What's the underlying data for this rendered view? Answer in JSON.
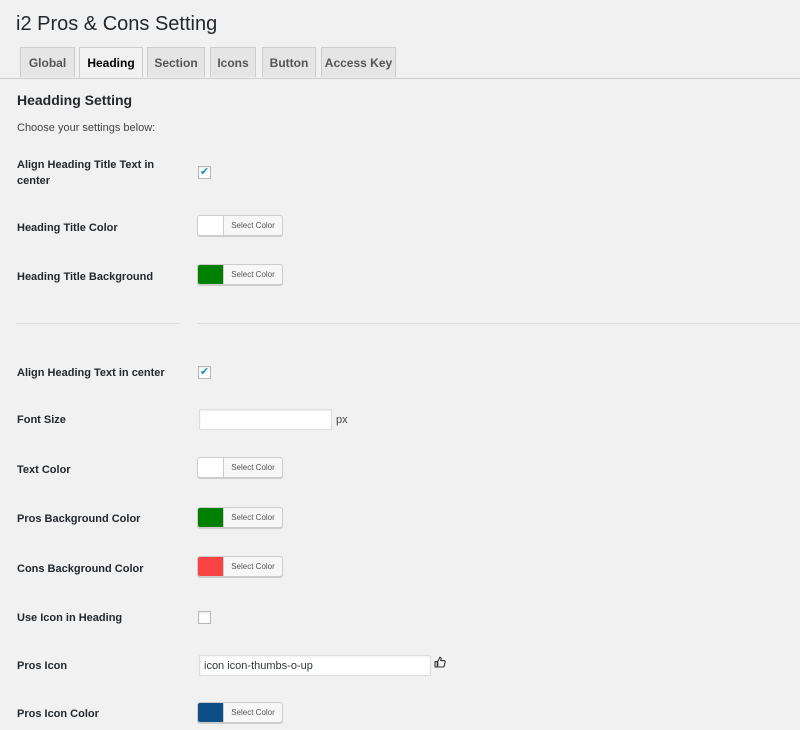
{
  "page": {
    "title": "i2 Pros & Cons Setting"
  },
  "tabs": [
    {
      "label": "Global"
    },
    {
      "label": "Heading",
      "active": true
    },
    {
      "label": "Section"
    },
    {
      "label": "Icons"
    },
    {
      "label": "Button"
    },
    {
      "label": "Access Key"
    }
  ],
  "heading_setting": {
    "title": "Headding Setting",
    "intro": "Choose your settings below:",
    "align_title_center": {
      "label": "Align Heading Title Text in center",
      "checked": true
    },
    "title_color": {
      "label": "Heading Title Color",
      "button": "Select Color",
      "color": "#ffffff"
    },
    "title_background": {
      "label": "Heading Title Background",
      "button": "Select Color",
      "color": "#008000"
    }
  },
  "heading_text": {
    "align_text_center": {
      "label": "Align Heading Text in center",
      "checked": true
    },
    "font_size": {
      "label": "Font Size",
      "value": "",
      "unit": "px"
    },
    "text_color": {
      "label": "Text Color",
      "button": "Select Color",
      "color": "#ffffff"
    },
    "pros_background": {
      "label": "Pros Background Color",
      "button": "Select Color",
      "color": "#008000"
    },
    "cons_background": {
      "label": "Cons Background Color",
      "button": "Select Color",
      "color": "#f94343"
    },
    "use_icon": {
      "label": "Use Icon in Heading",
      "checked": false
    },
    "pros_icon": {
      "label": "Pros Icon",
      "value": "icon icon-thumbs-o-up",
      "icon": "thumbs-up-icon"
    },
    "pros_icon_color": {
      "label": "Pros Icon Color",
      "button": "Select Color",
      "color": "#0e4e86"
    }
  }
}
